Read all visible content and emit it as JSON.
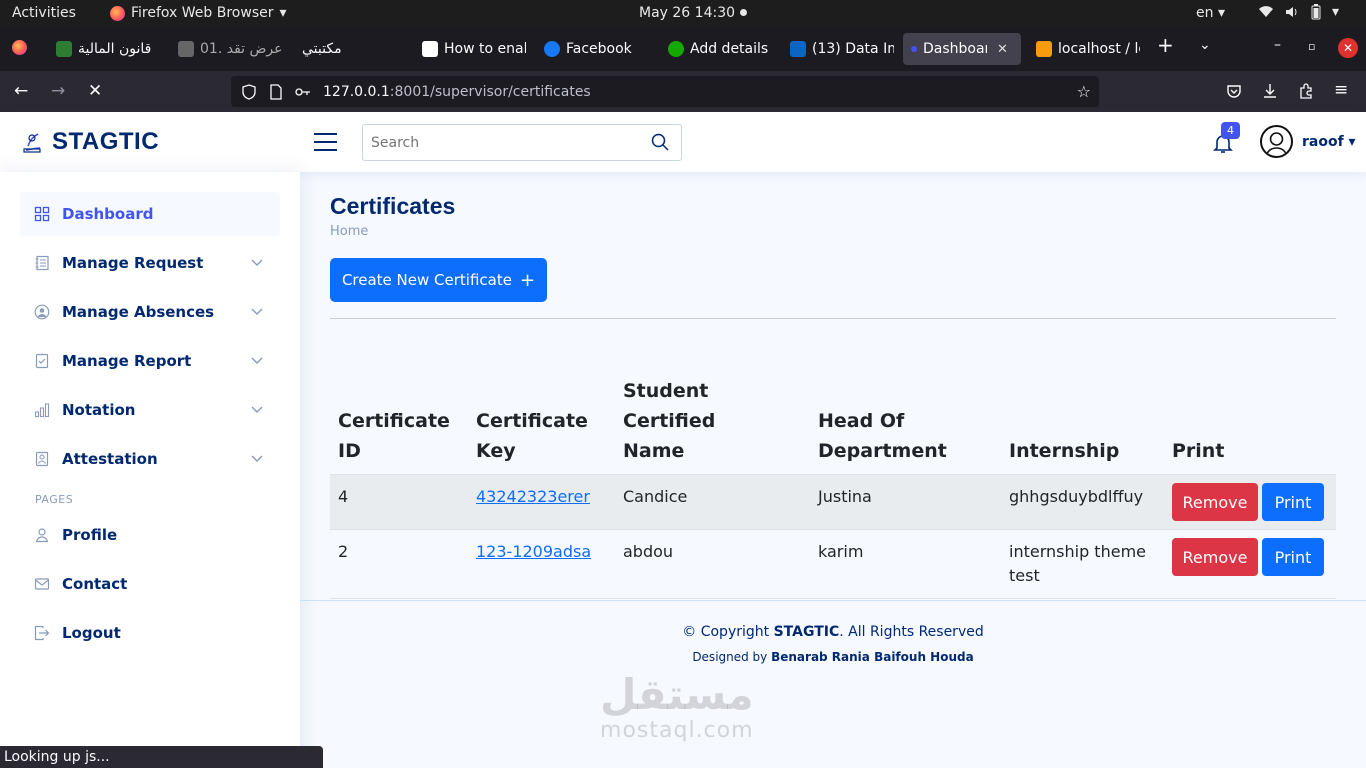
{
  "os_bar": {
    "activities": "Activities",
    "app_name": "Firefox Web Browser",
    "datetime": "May 26  14:30",
    "lang": "en"
  },
  "browser": {
    "tabs": [
      {
        "label": "قانون المالية",
        "color": "#2e7d32"
      },
      {
        "label": "01. عرض تقد",
        "color": "#666666"
      },
      {
        "label": "مكتبتي",
        "color": "#1c1b22"
      },
      {
        "label": "How to enal",
        "color": "#ffffff"
      },
      {
        "label": "Facebook",
        "color": "#1877f2"
      },
      {
        "label": "Add details",
        "color": "#14a800"
      },
      {
        "label": "(13) Data Im",
        "color": "#0a66c2"
      },
      {
        "label": "Dashboar",
        "color": "#4154f1"
      },
      {
        "label": "localhost / lo",
        "color": "#f89c0e"
      }
    ],
    "url_host": "127.0.0.1",
    "url_path": ":8001/supervisor/certificates",
    "status_text": "Looking up js..."
  },
  "header": {
    "brand": "STAGTIC",
    "search_placeholder": "Search",
    "notification_count": "4",
    "user_name": "raoof"
  },
  "sidebar": {
    "items": [
      {
        "label": "Dashboard",
        "icon": "grid-icon"
      },
      {
        "label": "Manage Request",
        "icon": "journal-icon"
      },
      {
        "label": "Manage Absences",
        "icon": "person-circle-icon"
      },
      {
        "label": "Manage Report",
        "icon": "file-check-icon"
      },
      {
        "label": "Notation",
        "icon": "bar-chart-icon"
      },
      {
        "label": "Attestation",
        "icon": "file-person-icon"
      }
    ],
    "pages_heading": "PAGES",
    "pages": [
      {
        "label": "Profile",
        "icon": "person-icon"
      },
      {
        "label": "Contact",
        "icon": "envelope-icon"
      },
      {
        "label": "Logout",
        "icon": "logout-icon"
      }
    ]
  },
  "main": {
    "title": "Certificates",
    "breadcrumb": "Home",
    "create_button": "Create New Certificate",
    "table": {
      "headers": {
        "id_line1": "Certificate",
        "id_line2": "ID",
        "key_line1": "Certificate",
        "key_line2": "Key",
        "name_line1": "Student Certified",
        "name_line2": "Name",
        "head_line1": "Head Of",
        "head_line2": "Department",
        "internship": "Internship",
        "print": "Print"
      },
      "rows": [
        {
          "id": "4",
          "key": "43242323erer",
          "name": "Candice",
          "head": "Justina",
          "internship": "ghhgsduybdlffuy",
          "remove": "Remove",
          "print": "Print"
        },
        {
          "id": "2",
          "key": "123-1209adsa",
          "name": "abdou",
          "head": "karim",
          "internship": "internship theme test",
          "remove": "Remove",
          "print": "Print"
        }
      ]
    }
  },
  "footer": {
    "copy_prefix": "© Copyright ",
    "copy_brand": "STAGTIC",
    "copy_suffix": ". All Rights Reserved",
    "designed_prefix": "Designed by ",
    "designed_names": "Benarab Rania Baifouh Houda"
  },
  "watermark": {
    "arabic": "مستقل",
    "latin": "mostaql.com"
  },
  "colors": {
    "brand": "#012970",
    "accent": "#4154f1",
    "primary": "#0d6efd",
    "danger": "#dc3545"
  }
}
